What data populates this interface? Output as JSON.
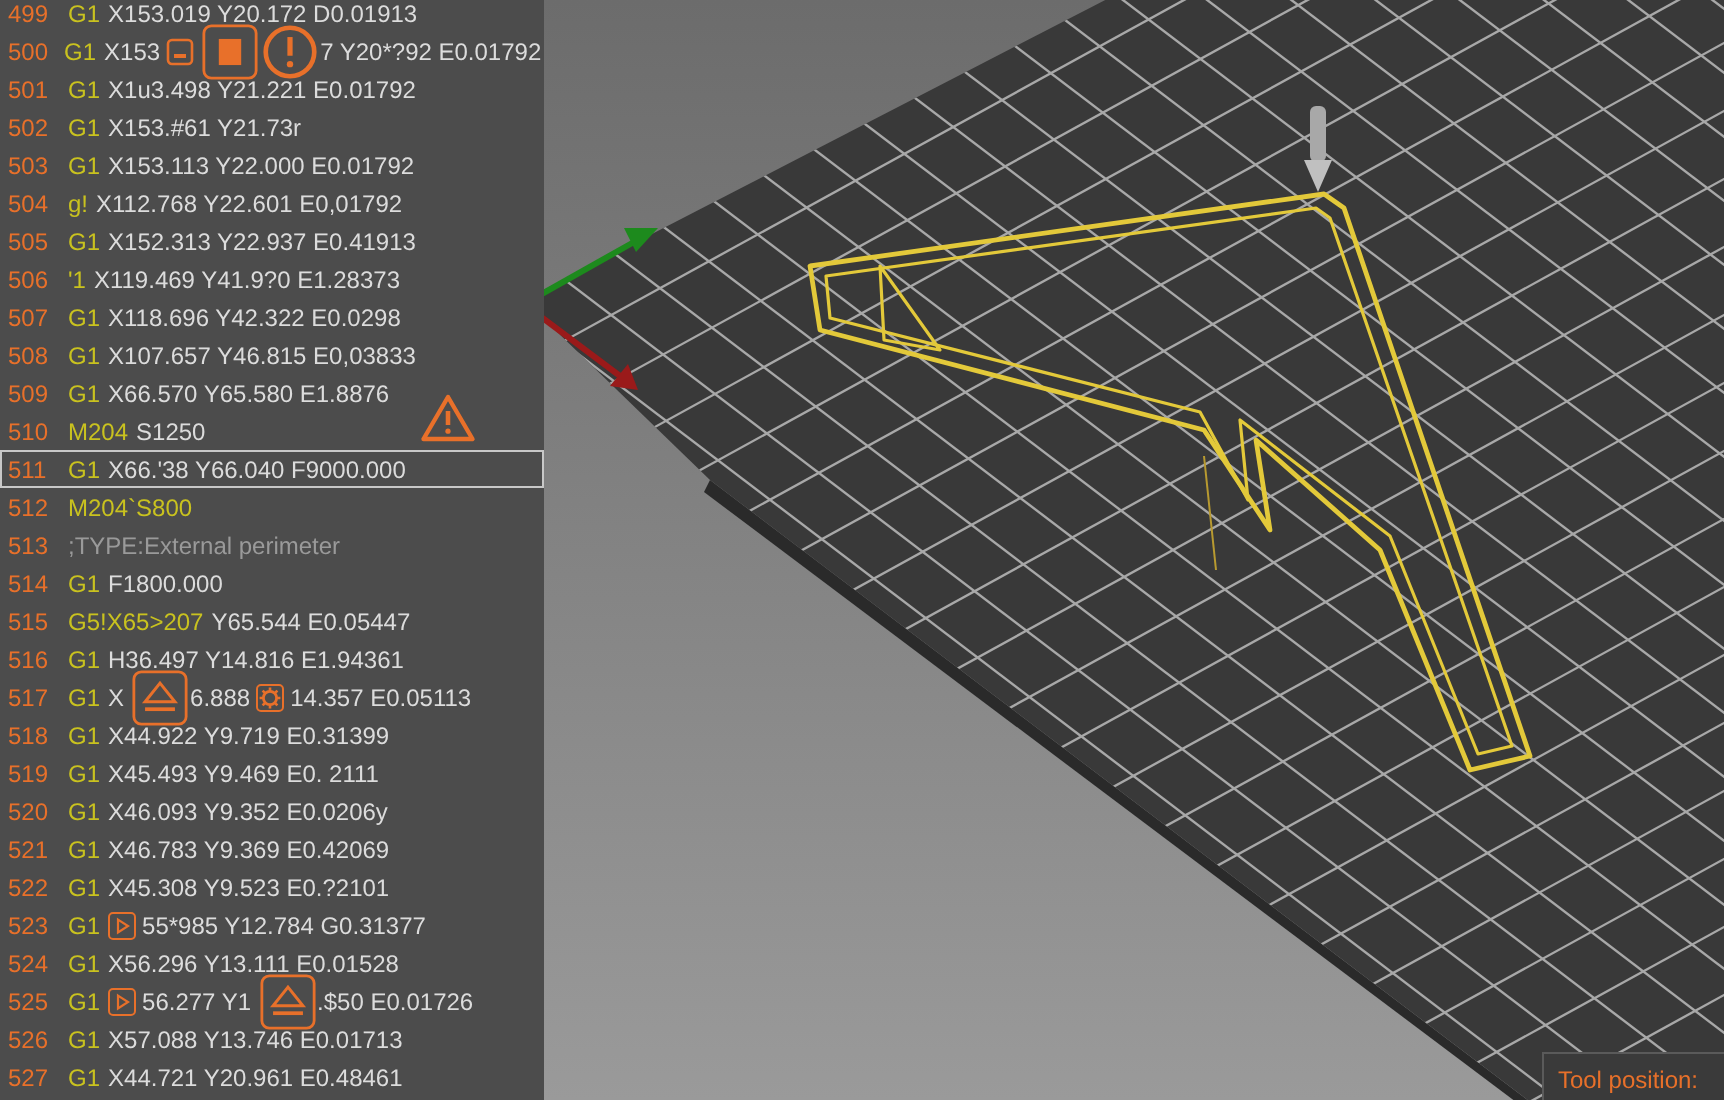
{
  "gcode_panel": {
    "rows": [
      {
        "line": "499",
        "selected": false,
        "parts": [
          {
            "kind": "command",
            "text": "G1"
          },
          {
            "kind": "text",
            "text": "X153.019 Y20.172 D0.01913"
          }
        ]
      },
      {
        "line": "500",
        "selected": false,
        "parts": [
          {
            "kind": "command",
            "text": "G1"
          },
          {
            "kind": "text",
            "text": "X153"
          },
          {
            "kind": "minus"
          },
          {
            "kind": "stop"
          },
          {
            "kind": "alert"
          },
          {
            "kind": "text",
            "text": "7 Y20*?92 E0.01792"
          }
        ]
      },
      {
        "line": "501",
        "selected": false,
        "parts": [
          {
            "kind": "command",
            "text": "G1"
          },
          {
            "kind": "text",
            "text": "X1u3.498 Y21.221 E0.01792"
          }
        ]
      },
      {
        "line": "502",
        "selected": false,
        "parts": [
          {
            "kind": "command",
            "text": "G1"
          },
          {
            "kind": "text",
            "text": "X153.#61 Y21.73r"
          }
        ]
      },
      {
        "line": "503",
        "selected": false,
        "parts": [
          {
            "kind": "command",
            "text": "G1"
          },
          {
            "kind": "text",
            "text": "X153.113 Y22.000 E0.01792"
          }
        ]
      },
      {
        "line": "504",
        "selected": false,
        "parts": [
          {
            "kind": "command",
            "text": "g!"
          },
          {
            "kind": "text",
            "text": "X112.768 Y22.601 E0,01792"
          }
        ]
      },
      {
        "line": "505",
        "selected": false,
        "parts": [
          {
            "kind": "command",
            "text": "G1"
          },
          {
            "kind": "text",
            "text": "X152.313 Y22.937 E0.41913"
          }
        ]
      },
      {
        "line": "506",
        "selected": false,
        "parts": [
          {
            "kind": "command",
            "text": "'1"
          },
          {
            "kind": "text",
            "text": "X119.469 Y41.9?0 E1.28373"
          }
        ]
      },
      {
        "line": "507",
        "selected": false,
        "parts": [
          {
            "kind": "command",
            "text": "G1"
          },
          {
            "kind": "text",
            "text": "X118.696 Y42.322 E0.0298"
          }
        ]
      },
      {
        "line": "508",
        "selected": false,
        "parts": [
          {
            "kind": "command",
            "text": "G1"
          },
          {
            "kind": "text",
            "text": "X107.657 Y46.815 E0,03833"
          }
        ]
      },
      {
        "line": "509",
        "selected": false,
        "parts": [
          {
            "kind": "command",
            "text": "G1"
          },
          {
            "kind": "text",
            "text": "X66.570 Y65.580 E1.8876"
          },
          {
            "kind": "warning"
          }
        ]
      },
      {
        "line": "510",
        "selected": false,
        "parts": [
          {
            "kind": "command",
            "text": "M204"
          },
          {
            "kind": "text",
            "text": "S1250"
          }
        ]
      },
      {
        "line": "511",
        "selected": true,
        "parts": [
          {
            "kind": "command",
            "text": "G1"
          },
          {
            "kind": "text",
            "text": "X66.'38 Y66.040 F9000.000"
          }
        ]
      },
      {
        "line": "512",
        "selected": false,
        "parts": [
          {
            "kind": "command",
            "text": "M204`S800"
          }
        ]
      },
      {
        "line": "513",
        "selected": false,
        "parts": [
          {
            "kind": "comment",
            "text": ";TYPE:External perimeter"
          }
        ]
      },
      {
        "line": "514",
        "selected": false,
        "parts": [
          {
            "kind": "command",
            "text": "G1"
          },
          {
            "kind": "text",
            "text": "F1800.000"
          }
        ]
      },
      {
        "line": "515",
        "selected": false,
        "parts": [
          {
            "kind": "command",
            "text": "G5!X65>207"
          },
          {
            "kind": "text",
            "text": "Y65.544 E0.05447"
          }
        ]
      },
      {
        "line": "516",
        "selected": false,
        "parts": [
          {
            "kind": "command",
            "text": "G1"
          },
          {
            "kind": "text",
            "text": "H36.497 Y14.816 E1.94361"
          }
        ]
      },
      {
        "line": "517",
        "selected": false,
        "parts": [
          {
            "kind": "command",
            "text": "G1"
          },
          {
            "kind": "text",
            "text": "X"
          },
          {
            "kind": "eject"
          },
          {
            "kind": "text",
            "text": "6.888"
          },
          {
            "kind": "gear"
          },
          {
            "kind": "text",
            "text": "14.357 E0.05113"
          }
        ]
      },
      {
        "line": "518",
        "selected": false,
        "parts": [
          {
            "kind": "command",
            "text": "G1"
          },
          {
            "kind": "text",
            "text": "X44.922 Y9.719 E0.31399"
          }
        ]
      },
      {
        "line": "519",
        "selected": false,
        "parts": [
          {
            "kind": "command",
            "text": "G1"
          },
          {
            "kind": "text",
            "text": "X45.493 Y9.469 E0. 2111"
          }
        ]
      },
      {
        "line": "520",
        "selected": false,
        "parts": [
          {
            "kind": "command",
            "text": "G1"
          },
          {
            "kind": "text",
            "text": "X46.093 Y9.352 E0.0206y"
          }
        ]
      },
      {
        "line": "521",
        "selected": false,
        "parts": [
          {
            "kind": "command",
            "text": "G1"
          },
          {
            "kind": "text",
            "text": "X46.783 Y9.369 E0.42069"
          }
        ]
      },
      {
        "line": "522",
        "selected": false,
        "parts": [
          {
            "kind": "command",
            "text": "G1"
          },
          {
            "kind": "text",
            "text": "X45.308 Y9.523 E0.?2101"
          }
        ]
      },
      {
        "line": "523",
        "selected": false,
        "parts": [
          {
            "kind": "command",
            "text": "G1"
          },
          {
            "kind": "play"
          },
          {
            "kind": "text",
            "text": "55*985 Y12.784 G0.31377"
          }
        ]
      },
      {
        "line": "524",
        "selected": false,
        "parts": [
          {
            "kind": "command",
            "text": "G1"
          },
          {
            "kind": "text",
            "text": "X56.296 Y13.111 E0.01528"
          }
        ]
      },
      {
        "line": "525",
        "selected": false,
        "parts": [
          {
            "kind": "command",
            "text": "G1"
          },
          {
            "kind": "play"
          },
          {
            "kind": "text",
            "text": "56.277 Y1"
          },
          {
            "kind": "eject"
          },
          {
            "kind": "text",
            "text": ".$50 E0.01726"
          }
        ]
      },
      {
        "line": "526",
        "selected": false,
        "parts": [
          {
            "kind": "command",
            "text": "G1"
          },
          {
            "kind": "text",
            "text": "X57.088 Y13.746 E0.01713"
          }
        ]
      },
      {
        "line": "527",
        "selected": false,
        "parts": [
          {
            "kind": "command",
            "text": "G1"
          },
          {
            "kind": "text",
            "text": "X44.721 Y20.961 E0.48461"
          }
        ]
      }
    ]
  },
  "viewport": {
    "tool_position_label": "Tool position:"
  }
}
